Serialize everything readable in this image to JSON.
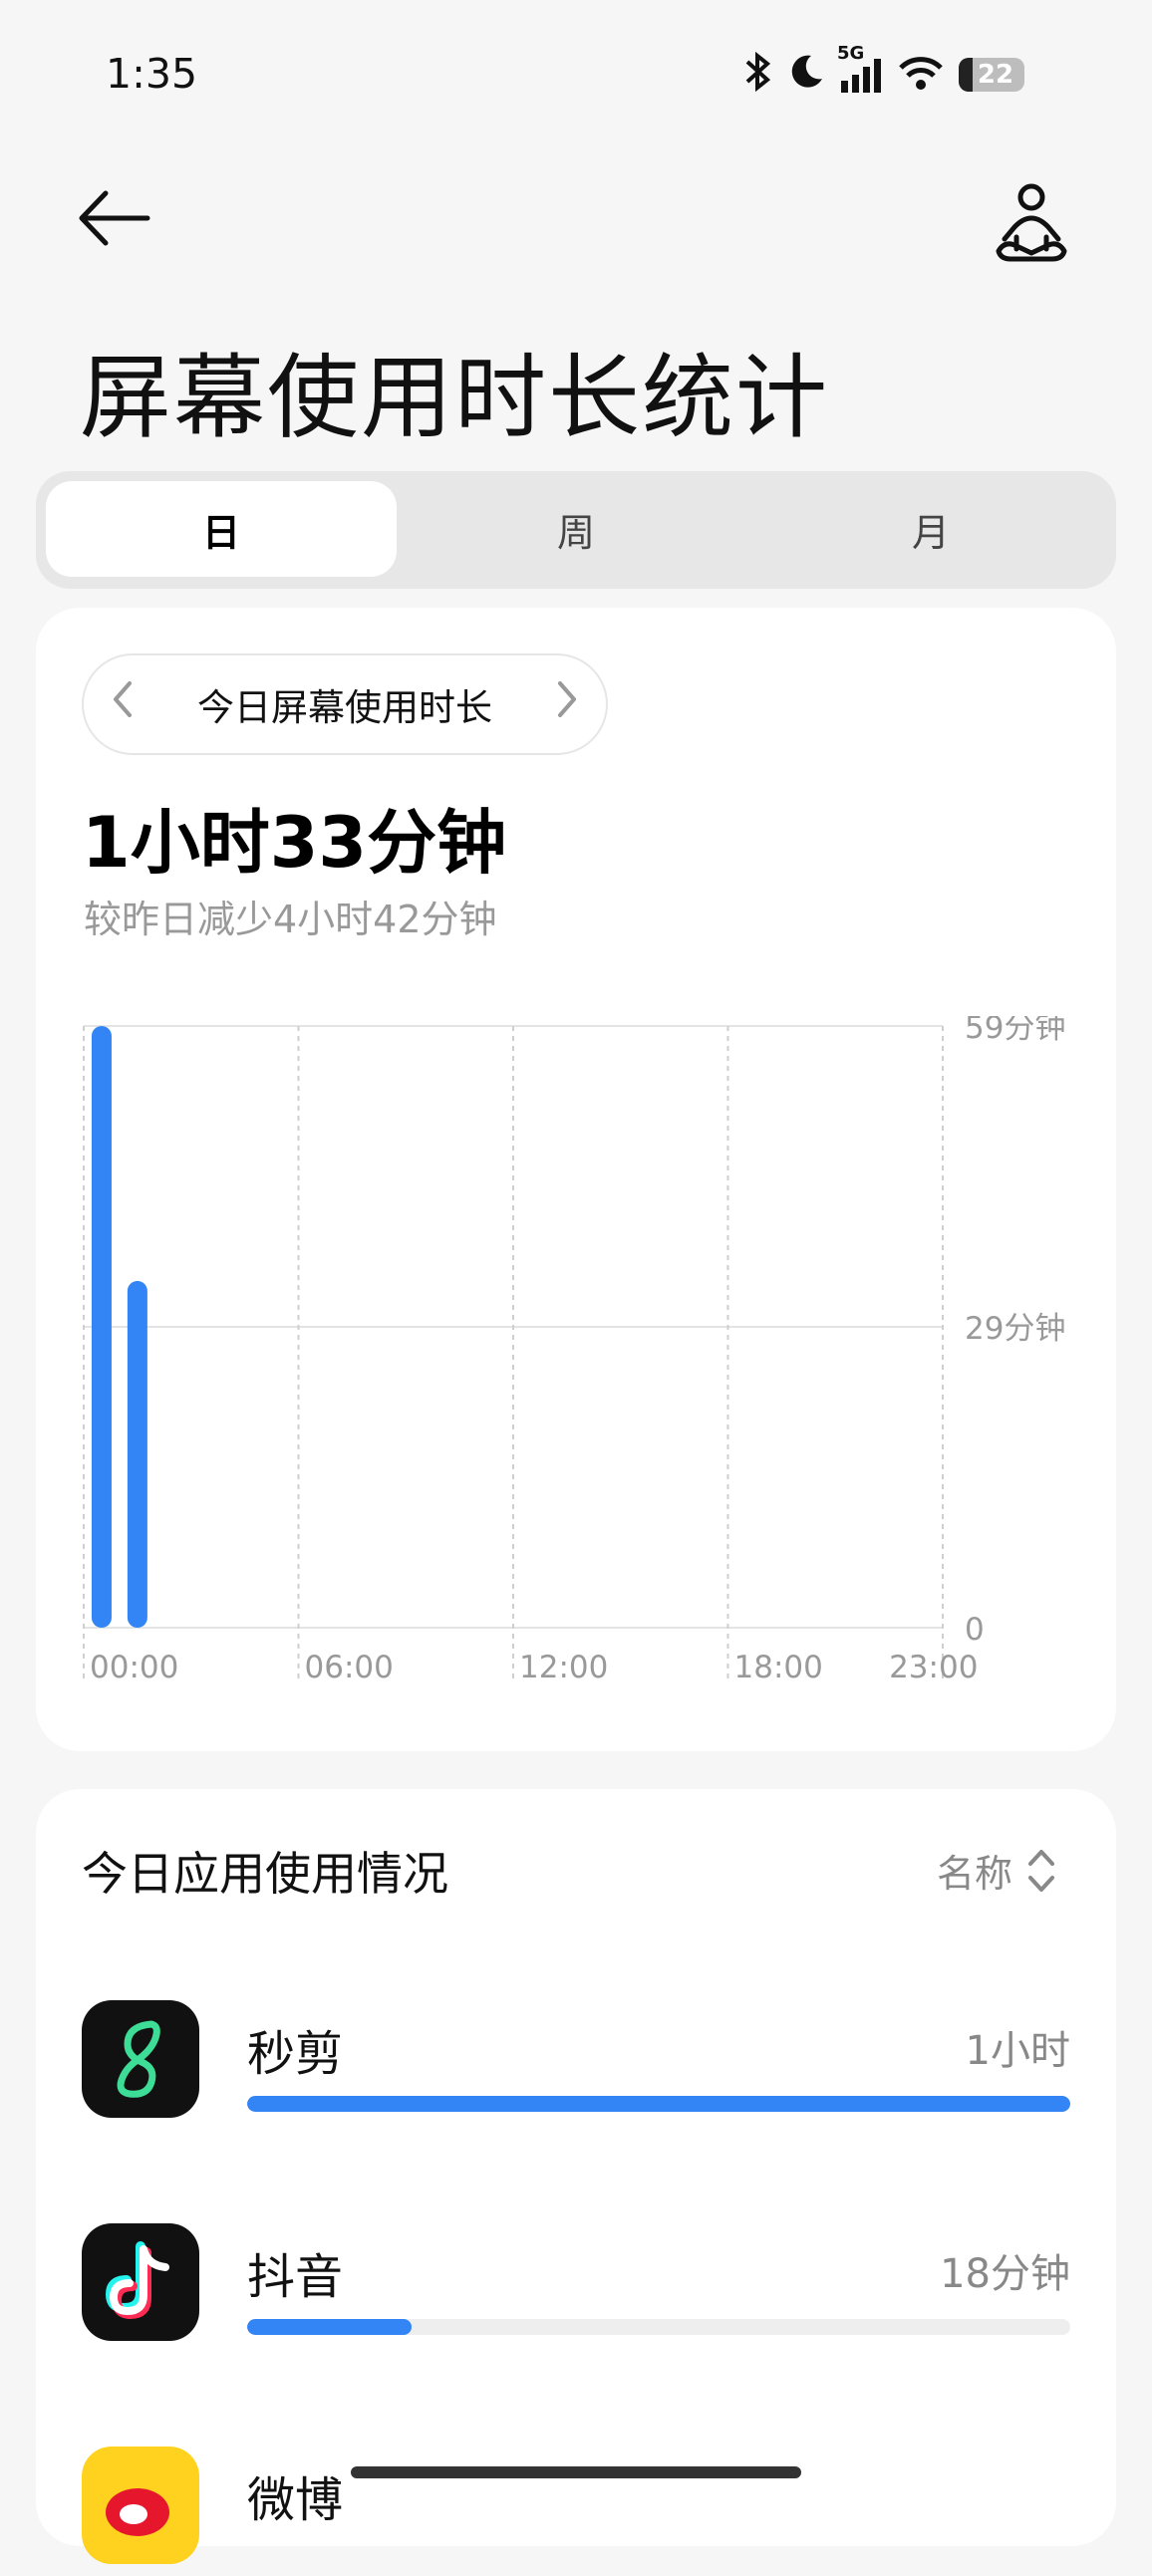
{
  "status_bar": {
    "time": "1:35",
    "network": "5G",
    "battery": "22"
  },
  "header": {
    "title": "屏幕使用时长统计"
  },
  "tabs": [
    {
      "label": "日",
      "active": true
    },
    {
      "label": "周",
      "active": false
    },
    {
      "label": "月",
      "active": false
    }
  ],
  "summary": {
    "period_label": "今日屏幕使用时长",
    "total": "1小时33分钟",
    "compare": "较昨日减少4小时42分钟"
  },
  "chart_data": {
    "type": "bar",
    "x_ticks": [
      "00:00",
      "06:00",
      "12:00",
      "18:00",
      "23:00"
    ],
    "y_ticks": [
      "59分钟",
      "29分钟",
      "0"
    ],
    "ylim": [
      0,
      59
    ],
    "categories": [
      "00:00",
      "01:00",
      "02:00",
      "03:00",
      "04:00",
      "05:00",
      "06:00",
      "07:00",
      "08:00",
      "09:00",
      "10:00",
      "11:00",
      "12:00",
      "13:00",
      "14:00",
      "15:00",
      "16:00",
      "17:00",
      "18:00",
      "19:00",
      "20:00",
      "21:00",
      "22:00",
      "23:00"
    ],
    "values": [
      59,
      34,
      0,
      0,
      0,
      0,
      0,
      0,
      0,
      0,
      0,
      0,
      0,
      0,
      0,
      0,
      0,
      0,
      0,
      0,
      0,
      0,
      0,
      0
    ],
    "bar_color": "#3385f5"
  },
  "app_list": {
    "title": "今日应用使用情况",
    "sort_label": "名称",
    "apps": [
      {
        "name": "秒剪",
        "time": "1小时",
        "fraction": 1.0,
        "icon": "miaojian-app-icon"
      },
      {
        "name": "抖音",
        "time": "18分钟",
        "fraction": 0.2,
        "icon": "douyin-app-icon"
      },
      {
        "name": "微博",
        "time": "",
        "fraction": 0.0,
        "icon": "weibo-app-icon"
      }
    ]
  },
  "colors": {
    "accent": "#3385f5",
    "background": "#f6f6f6",
    "card": "#ffffff"
  }
}
